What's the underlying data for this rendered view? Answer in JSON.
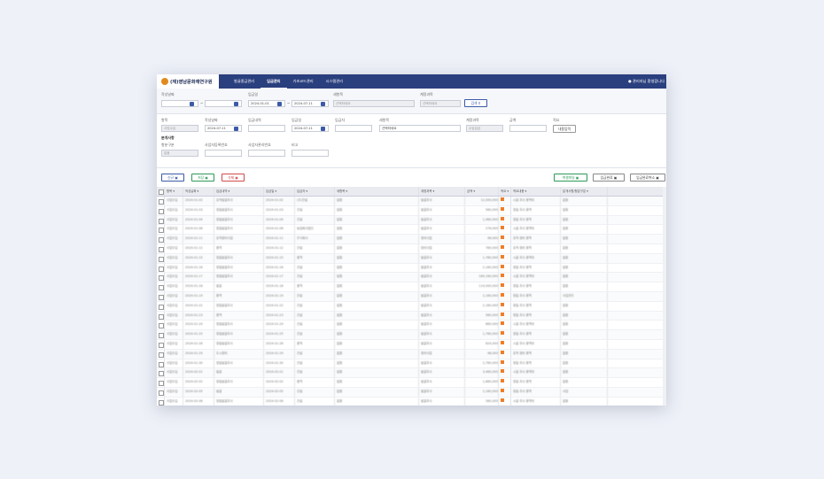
{
  "brand": {
    "name": "(재)영남문화재연구원"
  },
  "nav": {
    "items": [
      "발굴종금관리",
      "입금관리",
      "기초코드관리",
      "시스템관리"
    ],
    "user": "● 관리자님 환영합니다"
  },
  "search": {
    "date_label": "작성날짜",
    "date_from": "",
    "date_to": "",
    "deposit_label": "입금일",
    "deposit_from": "2024-01-01",
    "deposit_to": "2024-07-11",
    "project_label": "세항목",
    "project_ph": "선택하세요",
    "account_label": "계정과목",
    "account_ph": "선택하세요",
    "search_btn": "검색"
  },
  "form": {
    "item_label": "항목",
    "item_val": "사업수입",
    "date_label": "작성날짜",
    "date_val": "2024-07-11",
    "content_label": "입금내역",
    "deposit_label": "입금일",
    "deposit_val": "2024-07-11",
    "payer_label": "입금자",
    "project_label": "세항목",
    "project_ph": "선택하세요",
    "account_label": "계정과목",
    "account_val": "수입입금",
    "amount_label": "금액",
    "tax_label": "적요",
    "tax_btn": "내용입력",
    "section": "분개사항",
    "div_label": "항분구분",
    "div_val": "없음",
    "biz_label": "사업자등록번호",
    "sub_label": "사업자관리번호",
    "note_label": "비고"
  },
  "toolbar": {
    "new": "신규",
    "save": "저장",
    "del": "삭제",
    "excel": "엑셀파일",
    "confirm": "입금완료",
    "cancel": "입금완료취소"
  },
  "columns": [
    "항목",
    "작성날짜",
    "입금내역",
    "입금일",
    "입금자",
    "세항목",
    "계정과목",
    "금액",
    "적요",
    "적요내용",
    "분개사항/항분구분"
  ],
  "rows": [
    [
      "사업수입",
      "2024-01-02",
      "유적발굴조사",
      "2024-01-02",
      "(주)건설",
      "없음",
      "발굴조사",
      "12,000,000",
      "",
      "시굴 조사 용역비",
      "없음"
    ],
    [
      "사업수입",
      "2024-01-03",
      "정밀발굴조사",
      "2024-01-03",
      "건설",
      "없음",
      "발굴조사",
      "560,000",
      "",
      "정밀 조사 용역",
      "없음"
    ],
    [
      "사업수입",
      "2024-01-04",
      "정밀발굴조사",
      "2024-01-04",
      "건설",
      "없음",
      "발굴조사",
      "1,960,000",
      "",
      "정밀 조사 용역",
      "없음"
    ],
    [
      "사업수입",
      "2024-01-08",
      "정밀발굴조사",
      "2024-01-08",
      "농업회사법인",
      "없음",
      "발굴조사",
      "276,000",
      "",
      "시굴 조사 용역비",
      "없음"
    ],
    [
      "사업수입",
      "2024-01-11",
      "유적정비사업",
      "2024-01-11",
      "주식회사",
      "없음",
      "정비사업",
      "96,000",
      "",
      "유적 정비 용역",
      "없음"
    ],
    [
      "사업수입",
      "2024-01-12",
      "용역",
      "2024-01-12",
      "건설",
      "없음",
      "정비사업",
      "760,000",
      "",
      "유적 정비 용역",
      "없음"
    ],
    [
      "사업수입",
      "2024-01-15",
      "정밀발굴조사",
      "2024-01-15",
      "용역",
      "없음",
      "발굴조사",
      "1,760,000",
      "",
      "시굴 조사 용역비",
      "없음"
    ],
    [
      "사업수입",
      "2024-01-16",
      "정밀발굴조사",
      "2024-01-16",
      "건설",
      "없음",
      "발굴조사",
      "2,160,000",
      "",
      "정밀 조사 용역",
      "없음"
    ],
    [
      "사업수입",
      "2024-01-17",
      "정밀발굴조사",
      "2024-01-17",
      "건설",
      "없음",
      "발굴조사",
      "184,160,000",
      "",
      "시굴 조사 용역비",
      "없음"
    ],
    [
      "사업수입",
      "2024-01-18",
      "발굴",
      "2024-01-18",
      "용역",
      "없음",
      "발굴조사",
      "114,000,000",
      "",
      "정밀 조사 용역",
      "없음"
    ],
    [
      "사업수입",
      "2024-01-19",
      "용역",
      "2024-01-19",
      "건설",
      "없음",
      "발굴조사",
      "2,160,000",
      "",
      "정밀 조사 용역",
      "사업관리"
    ],
    [
      "사업수입",
      "2024-01-22",
      "정밀발굴조사",
      "2024-01-22",
      "건설",
      "없음",
      "발굴조사",
      "2,160,000",
      "",
      "정밀 조사 용역",
      "없음"
    ],
    [
      "사업수입",
      "2024-01-23",
      "용역",
      "2024-01-23",
      "건설",
      "없음",
      "발굴조사",
      "560,000",
      "",
      "정밀 조사 용역",
      "없음"
    ],
    [
      "사업수입",
      "2024-01-24",
      "정밀발굴조사",
      "2024-01-24",
      "건설",
      "없음",
      "발굴조사",
      "860,000",
      "",
      "시굴 조사 용역비",
      "없음"
    ],
    [
      "사업수입",
      "2024-01-25",
      "정밀발굴조사",
      "2024-01-25",
      "건설",
      "없음",
      "발굴조사",
      "1,760,000",
      "",
      "정밀 조사 용역",
      "없음"
    ],
    [
      "사업수입",
      "2024-01-26",
      "정밀발굴조사",
      "2024-01-26",
      "용역",
      "없음",
      "발굴조사",
      "624,000",
      "",
      "시굴 조사 용역비",
      "없음"
    ],
    [
      "사업수입",
      "2024-01-29",
      "도시정비",
      "2024-01-29",
      "건설",
      "없음",
      "정비사업",
      "48,000",
      "",
      "유적 정비 용역",
      "없음"
    ],
    [
      "사업수입",
      "2024-01-30",
      "정밀발굴조사",
      "2024-01-30",
      "건설",
      "없음",
      "발굴조사",
      "2,760,000",
      "",
      "정밀 조사 용역",
      "없음"
    ],
    [
      "사업수입",
      "2024-02-01",
      "발굴",
      "2024-02-01",
      "건설",
      "없음",
      "발굴조사",
      "3,460,000",
      "",
      "시굴 조사 용역비",
      "없음"
    ],
    [
      "사업수입",
      "2024-02-02",
      "정밀발굴조사",
      "2024-02-02",
      "용역",
      "없음",
      "발굴조사",
      "1,860,000",
      "",
      "정밀 조사 용역",
      "없음"
    ],
    [
      "사업수입",
      "2024-02-05",
      "발굴",
      "2024-02-05",
      "건설",
      "없음",
      "발굴조사",
      "2,160,000",
      "",
      "정밀 조사 용역",
      "사업"
    ],
    [
      "사업수입",
      "2024-02-06",
      "정밀발굴조사",
      "2024-02-06",
      "건설",
      "없음",
      "발굴조사",
      "560,000",
      "",
      "시굴 조사 용역비",
      "없음"
    ],
    [
      "사업수입",
      "2024-02-07",
      "정밀발굴조사",
      "2024-02-07",
      "건설",
      "없음",
      "발굴조사",
      "960,000",
      "",
      "시굴 조사 용역비",
      "없음"
    ],
    [
      "사업수입",
      "2024-02-08",
      "정밀발굴조사",
      "2024-02-08",
      "용역",
      "없음",
      "발굴조사",
      "600",
      "",
      "정밀 조사 용역",
      "없음"
    ]
  ]
}
